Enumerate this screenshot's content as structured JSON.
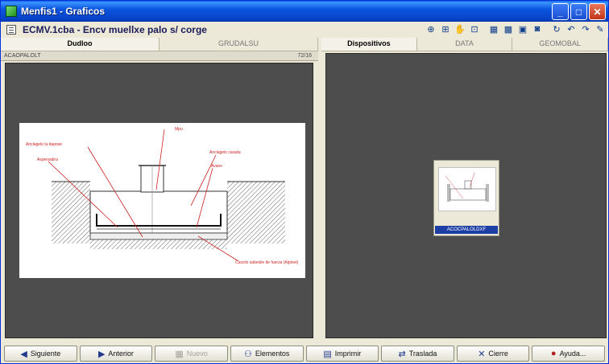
{
  "window": {
    "title": "Menfis1 - Graficos"
  },
  "document": {
    "title": "ECMV.1cba - Encv muellxe palo s/ corge"
  },
  "left_pane": {
    "tabs": [
      {
        "label": "Dudloo",
        "active": true
      },
      {
        "label": "GRUDALSU",
        "active": false
      }
    ],
    "file_label": "ACAOPALOLT",
    "zoom_label": "72/16"
  },
  "right_pane": {
    "tabs": [
      {
        "label": "Dispositivos",
        "active": true
      },
      {
        "label": "DATA",
        "active": false
      },
      {
        "label": "GEOMOBAL",
        "active": false
      }
    ],
    "thumbnail_caption": "ACOCPALOLDXF"
  },
  "drawing": {
    "labels": [
      "Mpu",
      "Anclagelo la dapose",
      "Anclagelo carada",
      "Asperaabra",
      "Avano",
      "Cuscilo sabelsle de fuerza (Alpinet)"
    ]
  },
  "bottom_buttons": [
    {
      "label": "Siguiente",
      "icon": "arrow-left-icon",
      "disabled": false
    },
    {
      "label": "Anterior",
      "icon": "arrow-right-icon",
      "disabled": false
    },
    {
      "label": "Nuevo",
      "icon": "grid-icon",
      "disabled": true
    },
    {
      "label": "Elementos",
      "icon": "users-icon",
      "disabled": false
    },
    {
      "label": "Imprimir",
      "icon": "printer-icon",
      "disabled": false
    },
    {
      "label": "Traslada",
      "icon": "transfer-icon",
      "disabled": false
    },
    {
      "label": "Cierre",
      "icon": "close-icon",
      "disabled": false
    },
    {
      "label": "Ayuda...",
      "icon": "help-icon",
      "disabled": false
    }
  ],
  "colors": {
    "titlebar": "#0b55df",
    "canvas": "#4d4d4d",
    "annotation": "#cc1f1f"
  }
}
